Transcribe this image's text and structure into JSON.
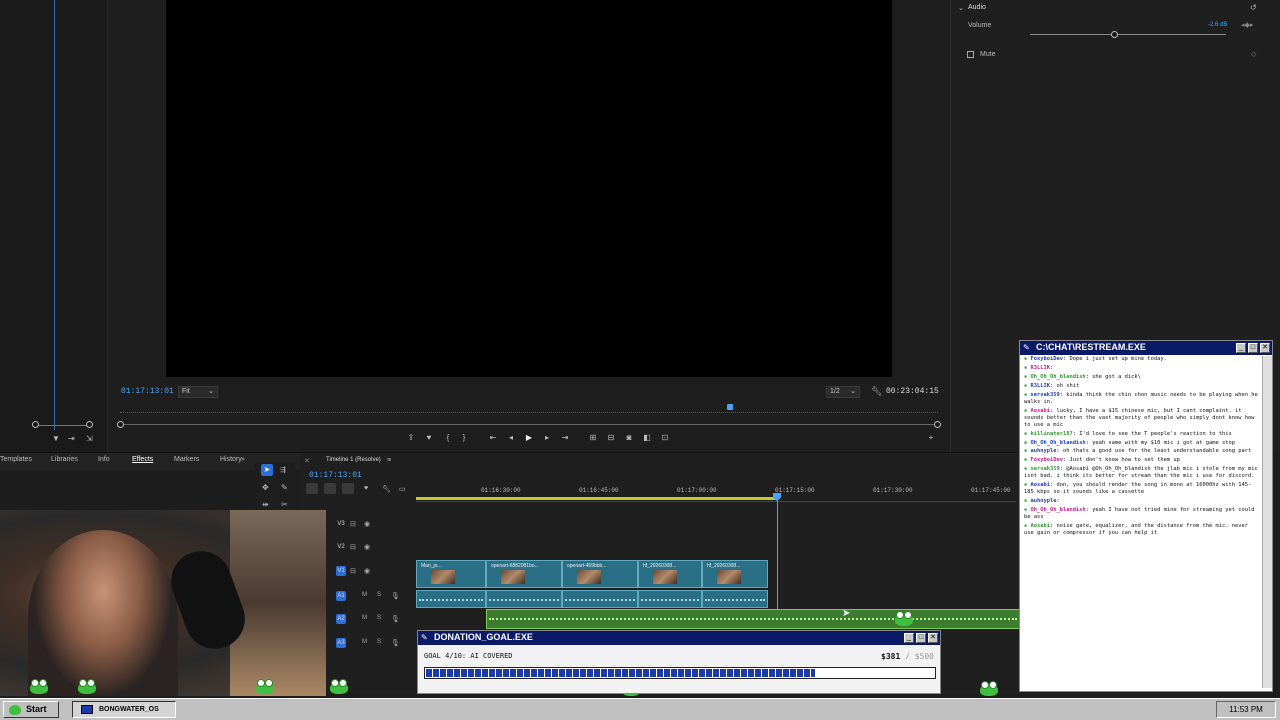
{
  "monitor": {
    "timecode_current": "01:17:13:01",
    "fit_label": "Fit",
    "resolution_label": "1/2",
    "timecode_duration": "00:23:04:15"
  },
  "effects_panel": {
    "section_label": "Audio",
    "volume_label": "Volume",
    "volume_value": "-2.6 dB",
    "mute_label": "Mute"
  },
  "panel_tabs": [
    "Templates",
    "Libraries",
    "Info",
    "Effects",
    "Markers",
    "History"
  ],
  "timeline": {
    "tab_label": "Timeline 1 (Resolve)",
    "timecode": "01:17:13:01",
    "ruler_ticks": [
      "01:16:30:00",
      "01:16:45:00",
      "01:17:00:00",
      "01:17:15:00",
      "01:17:30:00",
      "01:17:45:00"
    ],
    "tracks": [
      "V3",
      "V2",
      "V1",
      "A1",
      "A2",
      "A3"
    ],
    "clips": [
      "Man_jo...",
      "openart-6882081bo...",
      "openart-459bbb...",
      "hf_20260308...",
      "hf_20260308..."
    ]
  },
  "chat": {
    "title": "C:\\CHAT\\RESTREAM.EXE",
    "messages": [
      {
        "user": "FoxyboiDev",
        "text": "Dope i just set up mine today."
      },
      {
        "user": "R3LLIK",
        "text": ""
      },
      {
        "user": "Oh_Oh_Oh_blandish",
        "text": "she got a dick\\"
      },
      {
        "user": "R3LLIK",
        "text": "oh shit"
      },
      {
        "user": "servak359",
        "text": "kinda think the chin chon music needs to be playing when he walks in."
      },
      {
        "user": "Aosabi",
        "text": "lucky, I have a $15 chinese mic, but I cant complaint. it sounds better than the vast majority of people who simply dont know how to use a mic"
      },
      {
        "user": "killinater187",
        "text": "I'd love to see the T people's reaction to this"
      },
      {
        "user": "Oh_Oh_Oh_blandish",
        "text": "yeah same with my $10 mic i got at game stop"
      },
      {
        "user": "auhnyple",
        "text": "oh thats a good use for the least understandable song part"
      },
      {
        "user": "FoxyboiDev",
        "text": "Just don't know how to set them up"
      },
      {
        "user": "servak359",
        "text": "@Aosabi @Oh_Oh_Oh_blandish the jlab mic i stole from my mic isnt bad. i think its better for stream than the mic i use for discord."
      },
      {
        "user": "Aosabi",
        "text": "don, you should render the song in mono at 16000hz with 145-185 kbps so it sounds like a cassette"
      },
      {
        "user": "auhnyple",
        "text": ""
      },
      {
        "user": "Oh_Oh_Oh_blandish",
        "text": "yeah I have not tried mine for streaming yet could be ass"
      },
      {
        "user": "Aosabi",
        "text": "noise gate, equalizer, and the distance from the mic. never use gain or compressor if you can help it"
      }
    ]
  },
  "donation": {
    "title": "DONATION_GOAL.EXE",
    "goal_text": "GOAL 4/10: AI COVERED",
    "amount": "$381",
    "target": "/ $500",
    "progress_fraction": 0.762
  },
  "taskbar": {
    "start_label": "Start",
    "task_label": "BONGWATER_OS",
    "clock": "11:53 PM"
  },
  "colors": {
    "accent_blue": "#4aa3ff",
    "retro_title": "#0a1a66",
    "clip_video": "#2a6f86",
    "clip_audio_green": "#3d7d2f",
    "frog_green": "#3fbf3f",
    "chat_user_blue": "#1f3fb0",
    "chat_user_pink": "#c0208f",
    "chat_user_green": "#2f9a2f"
  }
}
